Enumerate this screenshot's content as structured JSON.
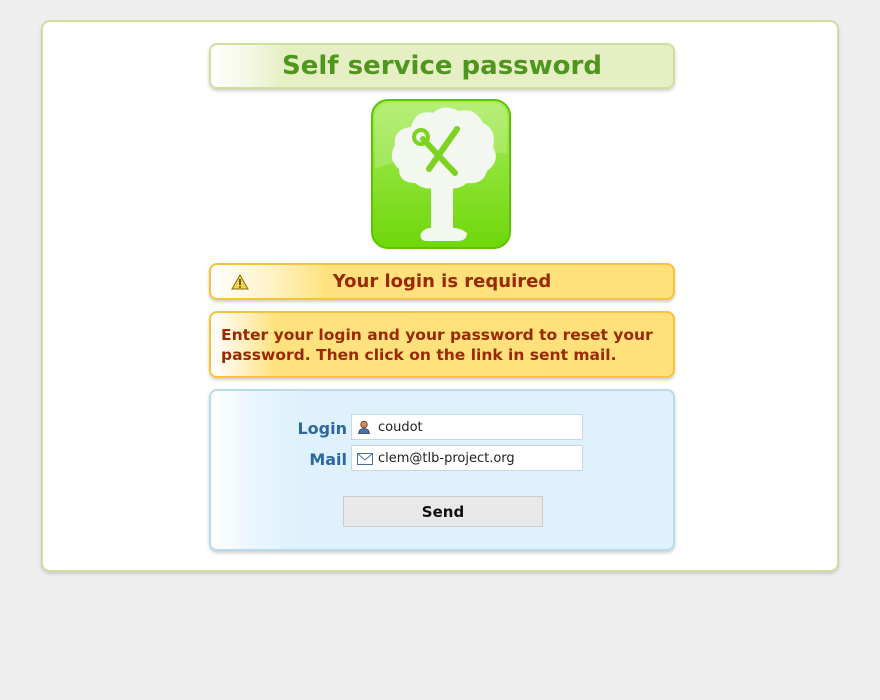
{
  "header": {
    "title": "Self service password"
  },
  "logo": {
    "icon": "tree-tools-icon",
    "color": "#7ed321"
  },
  "alert": {
    "icon": "warning-icon",
    "text": "Your login is required"
  },
  "help": {
    "text": "Enter your login and your password to reset your password. Then click on the link in sent mail."
  },
  "form": {
    "login_label": "Login",
    "login_value": "coudot",
    "login_icon": "user-icon",
    "mail_label": "Mail",
    "mail_value": "clem@tlb-project.org",
    "mail_icon": "envelope-icon",
    "send_label": "Send"
  },
  "colors": {
    "title_text": "#4e961c",
    "alert_text": "#9a2800",
    "label_text": "#2e67a0",
    "panel_border": "#cfdf9e",
    "alert_border": "#f5c438",
    "form_border": "#b8daea"
  }
}
